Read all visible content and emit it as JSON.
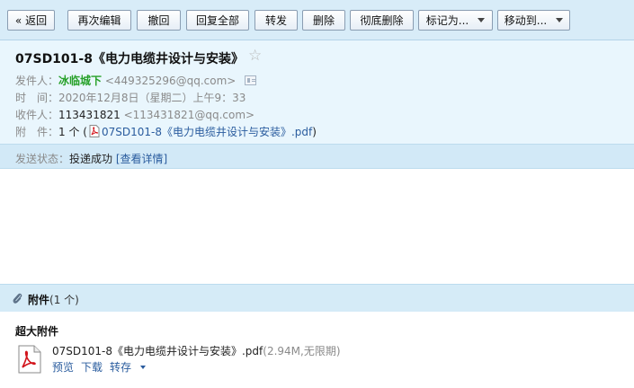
{
  "toolbar": {
    "back": "« 返回",
    "edit_again": "再次编辑",
    "recall": "撤回",
    "reply_all": "回复全部",
    "forward": "转发",
    "delete": "删除",
    "delete_permanently": "彻底删除",
    "mark_as": "标记为...",
    "move_to": "移动到..."
  },
  "email": {
    "subject": "07SD101-8《电力电缆井设计与安装》",
    "sender_label": "发件人：",
    "sender_name": "冰临城下",
    "sender_email": "<449325296@qq.com>",
    "time_label": "时　间：",
    "time": "2020年12月8日（星期二）上午9：33",
    "recipient_label": "收件人：",
    "recipient_name": "113431821",
    "recipient_email": "<113431821@qq.com>",
    "attachment_label": "附　件：",
    "attachment_count": "1 个 (",
    "attachment_link": "07SD101-8《电力电缆井设计与安装》.pdf",
    "attachment_close": ")"
  },
  "status": {
    "label": "发送状态：",
    "value": "投递成功",
    "details": "[查看详情]"
  },
  "attachments": {
    "title": "附件",
    "count": "(1 个)",
    "big_label": "超大附件",
    "file_name": "07SD101-8《电力电缆井设计与安装》.pdf",
    "file_meta": "(2.94M,无限期)",
    "preview": "预览",
    "download": "下载",
    "save_to": "转存"
  },
  "colors": {
    "toolbar_bg": "#d8ecf8",
    "header_bg": "#e9f6fd",
    "link": "#2a5c9e",
    "sender_green": "#26a028"
  },
  "icons": [
    "star-icon",
    "contact-card-icon",
    "pdf-icon",
    "paperclip-icon",
    "chevron-down-icon"
  ]
}
